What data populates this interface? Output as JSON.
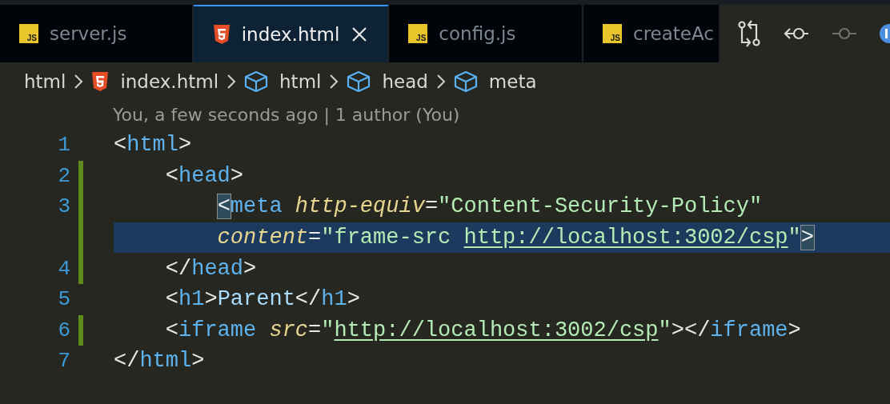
{
  "tabs": [
    {
      "kind": "js",
      "badge": "JS",
      "label": "server.js",
      "selected": false
    },
    {
      "kind": "html",
      "label": "index.html",
      "selected": true
    },
    {
      "kind": "js",
      "badge": "JS",
      "label": "config.js",
      "selected": false
    },
    {
      "kind": "js",
      "badge": "JS",
      "label": "createAc",
      "selected": false
    }
  ],
  "breadcrumb": [
    {
      "kind": "folder",
      "label": "html"
    },
    {
      "kind": "html",
      "label": "index.html"
    },
    {
      "kind": "element",
      "label": "html"
    },
    {
      "kind": "element",
      "label": "head"
    },
    {
      "kind": "element",
      "label": "meta"
    }
  ],
  "codelens": "You, a few seconds ago | 1 author (You)",
  "lines": [
    {
      "number": "1",
      "modified": false,
      "rows": [
        {
          "current": false,
          "tokens": [
            {
              "kind": "punct",
              "text": "<"
            },
            {
              "kind": "tag",
              "text": "html"
            },
            {
              "kind": "punct",
              "text": ">"
            }
          ]
        }
      ]
    },
    {
      "number": "2",
      "modified": true,
      "rows": [
        {
          "current": false,
          "tokens": [
            {
              "kind": "punct",
              "text": "    <"
            },
            {
              "kind": "tag",
              "text": "head"
            },
            {
              "kind": "punct",
              "text": ">"
            }
          ]
        }
      ]
    },
    {
      "number": "3",
      "modified": true,
      "rows": [
        {
          "current": false,
          "tokens": [
            {
              "kind": "match",
              "text": "        <"
            },
            {
              "kind": "tag",
              "text": "meta"
            },
            {
              "kind": "attr",
              "text": " http-equiv"
            },
            {
              "kind": "punct",
              "text": "="
            },
            {
              "kind": "string",
              "text": "\"Content-Security-Policy\""
            }
          ]
        },
        {
          "current": true,
          "tokens": [
            {
              "kind": "attr",
              "text": "        content"
            },
            {
              "kind": "punct",
              "text": "="
            },
            {
              "kind": "string",
              "text": "\"frame-src "
            },
            {
              "kind": "link",
              "text": "http://localhost:3002/csp"
            },
            {
              "kind": "string",
              "text": "\""
            },
            {
              "kind": "match",
              "text": ">"
            }
          ]
        }
      ]
    },
    {
      "number": "4",
      "modified": true,
      "rows": [
        {
          "current": false,
          "tokens": [
            {
              "kind": "punct",
              "text": "    </"
            },
            {
              "kind": "tag",
              "text": "head"
            },
            {
              "kind": "punct",
              "text": ">"
            }
          ]
        }
      ]
    },
    {
      "number": "5",
      "modified": false,
      "rows": [
        {
          "current": false,
          "tokens": [
            {
              "kind": "punct",
              "text": "    <"
            },
            {
              "kind": "tag",
              "text": "h1"
            },
            {
              "kind": "punct",
              "text": ">"
            },
            {
              "kind": "text",
              "text": "Parent"
            },
            {
              "kind": "punct",
              "text": "</"
            },
            {
              "kind": "tag",
              "text": "h1"
            },
            {
              "kind": "punct",
              "text": ">"
            }
          ]
        }
      ]
    },
    {
      "number": "6",
      "modified": true,
      "rows": [
        {
          "current": false,
          "tokens": [
            {
              "kind": "punct",
              "text": "    <"
            },
            {
              "kind": "tag",
              "text": "iframe"
            },
            {
              "kind": "attr",
              "text": " src"
            },
            {
              "kind": "punct",
              "text": "="
            },
            {
              "kind": "string",
              "text": "\""
            },
            {
              "kind": "link",
              "text": "http://localhost:3002/csp"
            },
            {
              "kind": "string",
              "text": "\""
            },
            {
              "kind": "punct",
              "text": "></"
            },
            {
              "kind": "tag",
              "text": "iframe"
            },
            {
              "kind": "punct",
              "text": ">"
            }
          ]
        }
      ]
    },
    {
      "number": "7",
      "modified": false,
      "rows": [
        {
          "current": false,
          "tokens": [
            {
              "kind": "punct",
              "text": "</"
            },
            {
              "kind": "tag",
              "text": "html"
            },
            {
              "kind": "punct",
              "text": ">"
            }
          ]
        }
      ]
    }
  ]
}
